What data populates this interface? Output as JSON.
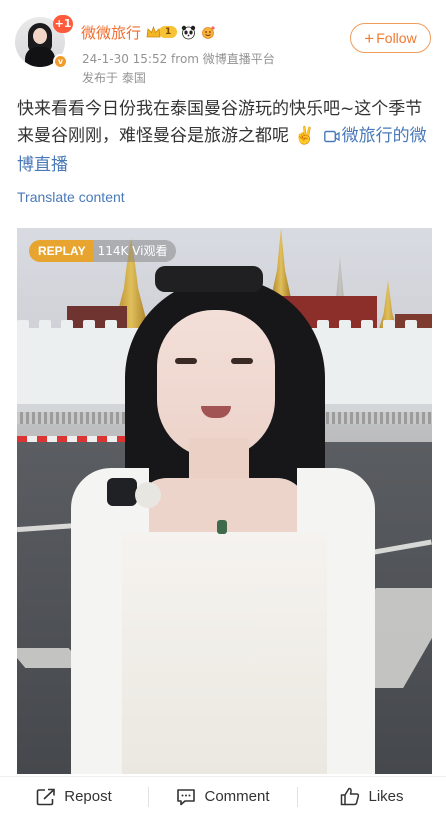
{
  "author": {
    "name": "微微旅行",
    "plus_badge": "+1",
    "level": "1",
    "verified_badge": "v"
  },
  "follow_label": "Follow",
  "post": {
    "time_source": "24-1-30 15:52  from 微博直播平台",
    "location": "发布于 泰国",
    "text": "快来看看今日份我在泰国曼谷游玩的快乐吧~这个季节来曼谷刚刚，难怪曼谷是旅游之都呢",
    "emoji": "✌️",
    "link_text": "微旅行的微博直播",
    "translate_label": "Translate content"
  },
  "video": {
    "replay_label": "REPLAY",
    "views_label": "114K Vi观看"
  },
  "actions": {
    "repost": "Repost",
    "comment": "Comment",
    "likes": "Likes"
  },
  "colors": {
    "username": "#f16d2d",
    "link": "#4a79b8",
    "follow_border": "#f09c5c",
    "replay": "#e7a530"
  },
  "icons": [
    "crown-icon",
    "panda-icon",
    "sun-icon",
    "video-link-icon",
    "repost-icon",
    "comment-icon",
    "like-icon"
  ]
}
